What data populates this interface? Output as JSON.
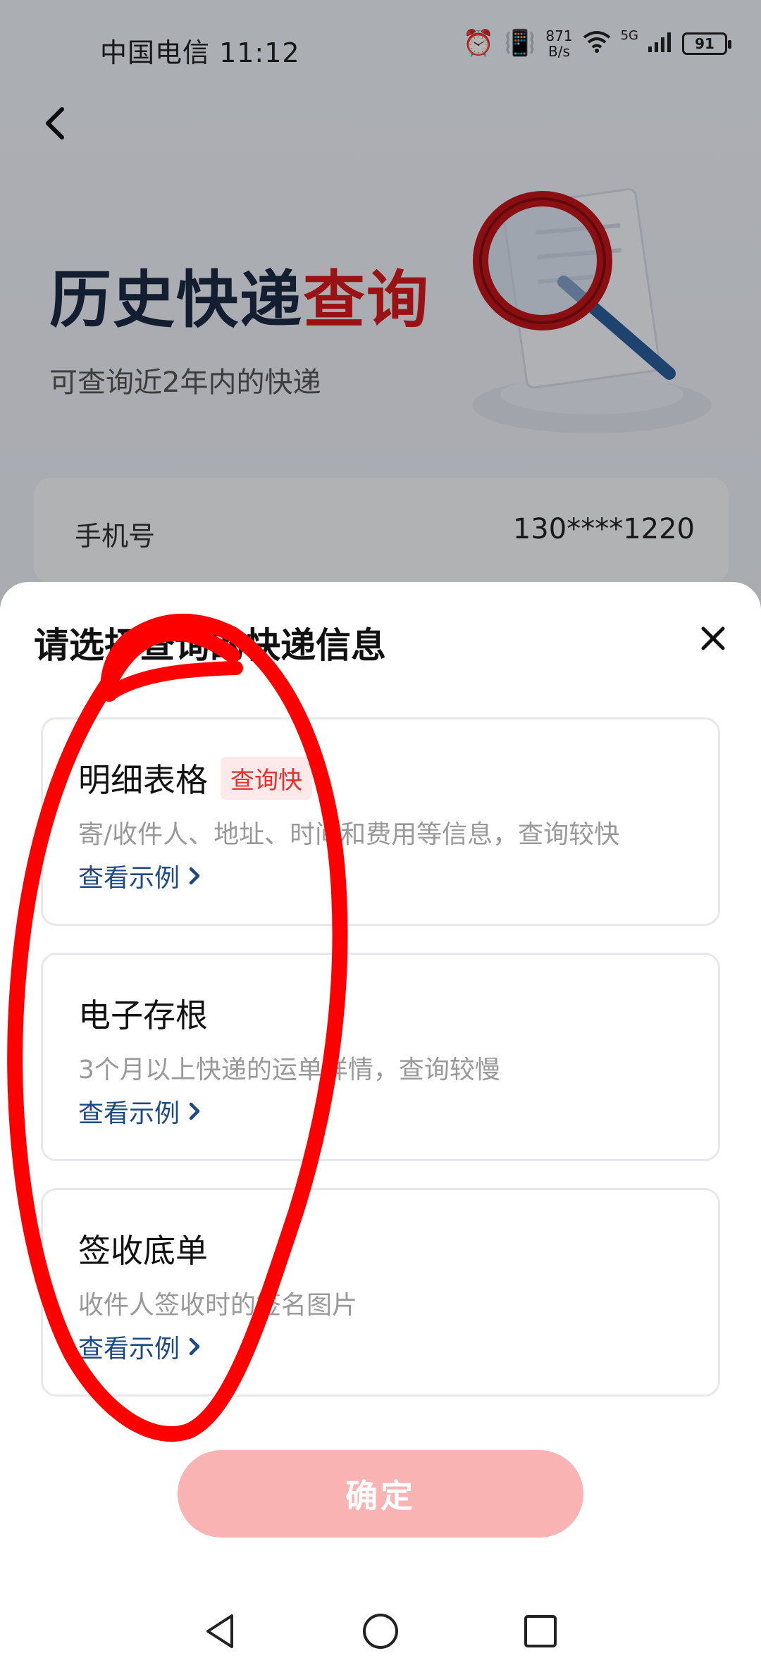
{
  "status_bar": {
    "carrier_time": "中国电信 11:12",
    "net_speed_value": "871",
    "net_speed_unit": "B/s",
    "signal_label": "5G",
    "battery": "91"
  },
  "hero": {
    "title_main": "历史快递",
    "title_accent": "查询",
    "subtitle": "可查询近2年内的快递"
  },
  "phone_field": {
    "label": "手机号",
    "value": "130****1220"
  },
  "sheet": {
    "title": "请选择查询的快递信息",
    "options": [
      {
        "title": "明细表格",
        "badge": "查询快",
        "description": "寄/收件人、地址、时间和费用等信息，查询较快",
        "link": "查看示例"
      },
      {
        "title": "电子存根",
        "description": "3个月以上快递的运单详情，查询较慢",
        "link": "查看示例"
      },
      {
        "title": "签收底单",
        "description": "收件人签收时的签名图片",
        "link": "查看示例"
      }
    ],
    "confirm_label": "确定"
  },
  "colors": {
    "accent_red": "#d7191d",
    "title_dark": "#1c2a44",
    "link_blue": "#1d4a86",
    "confirm_disabled": "#f9b3b3",
    "scribble": "#ff0000"
  }
}
